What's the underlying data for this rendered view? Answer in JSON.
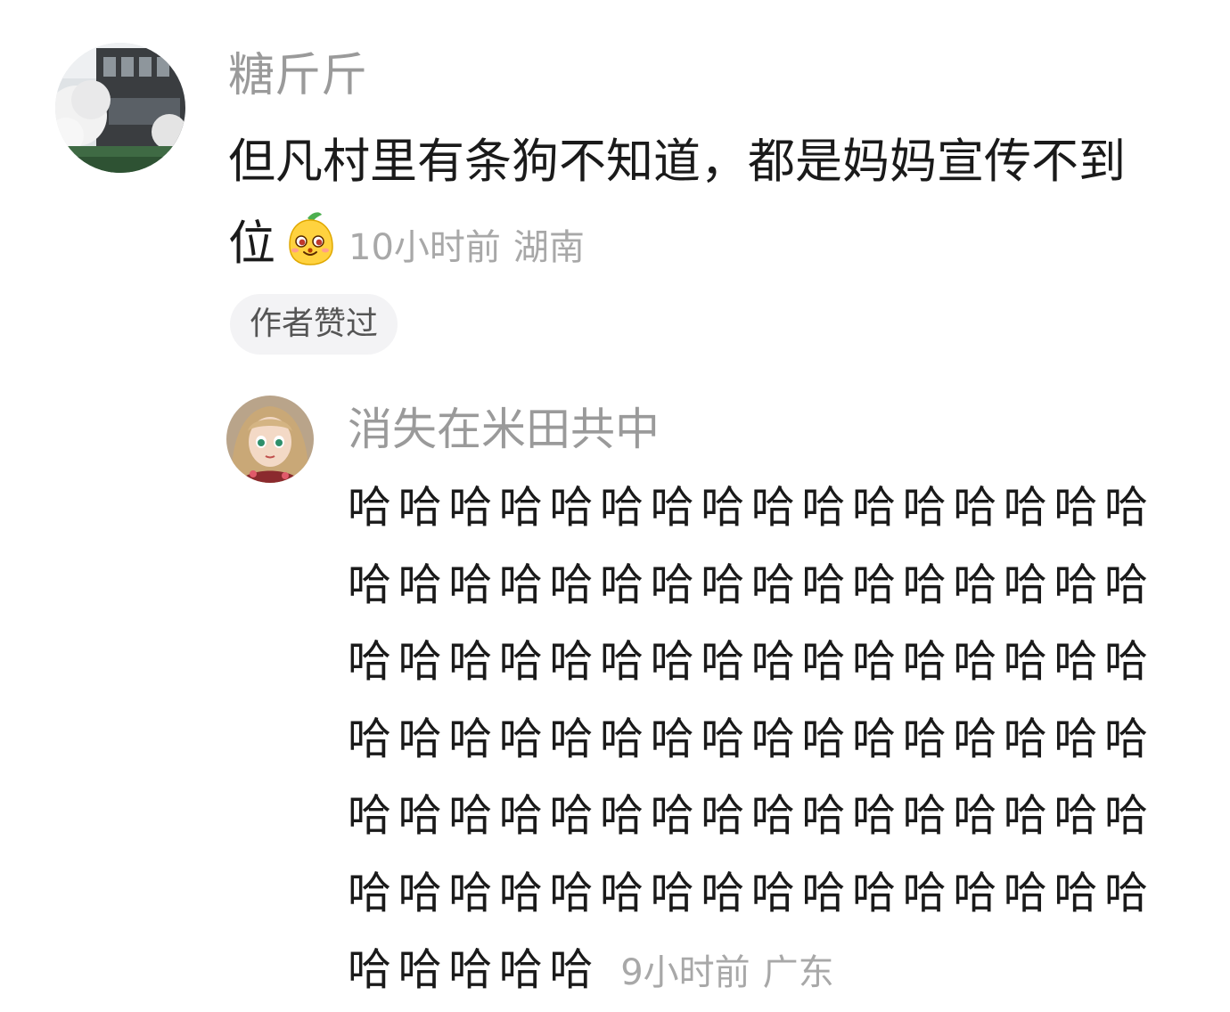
{
  "comment": {
    "username": "糖斤斤",
    "text_line1": "但凡村里有条狗不知道，都是妈妈宣传不到",
    "text_line2": "位",
    "emoji": "smug-face-emoji",
    "time": "10小时前",
    "location": "湖南",
    "author_liked": "作者赞过",
    "avatar": "avatar-building-photo"
  },
  "reply": {
    "username": "消失在米田共中",
    "avatar": "avatar-doll-photo",
    "lines": [
      "哈哈哈哈哈哈哈哈哈哈哈哈哈哈哈哈",
      "哈哈哈哈哈哈哈哈哈哈哈哈哈哈哈哈",
      "哈哈哈哈哈哈哈哈哈哈哈哈哈哈哈哈",
      "哈哈哈哈哈哈哈哈哈哈哈哈哈哈哈哈",
      "哈哈哈哈哈哈哈哈哈哈哈哈哈哈哈哈",
      "哈哈哈哈哈哈哈哈哈哈哈哈哈哈哈哈"
    ],
    "last_line": "哈哈哈哈哈",
    "time": "9小时前",
    "location": "广东"
  }
}
